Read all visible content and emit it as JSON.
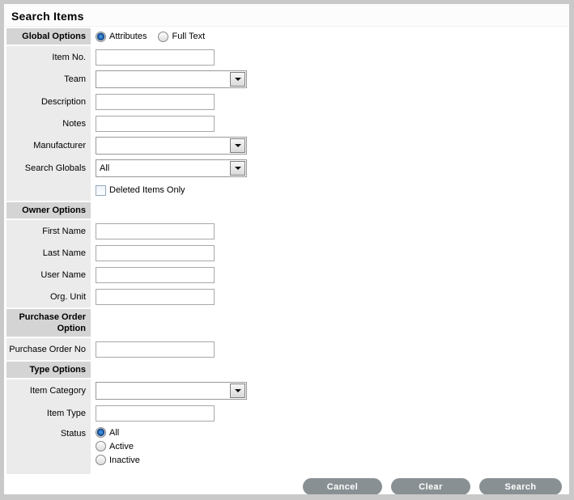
{
  "header": {
    "title": "Search Items"
  },
  "global_options": {
    "section_label": "Global Options",
    "search_mode": {
      "options": [
        {
          "label": "Attributes",
          "selected": true
        },
        {
          "label": "Full Text",
          "selected": false
        }
      ]
    },
    "fields": {
      "item_no": {
        "label": "Item No.",
        "value": ""
      },
      "team": {
        "label": "Team",
        "value": ""
      },
      "description": {
        "label": "Description",
        "value": ""
      },
      "notes": {
        "label": "Notes",
        "value": ""
      },
      "manufacturer": {
        "label": "Manufacturer",
        "value": ""
      },
      "search_globals": {
        "label": "Search Globals",
        "value": "All"
      }
    },
    "deleted_items_only": {
      "label": "Deleted Items Only",
      "checked": false
    }
  },
  "owner_options": {
    "section_label": "Owner Options",
    "fields": {
      "first_name": {
        "label": "First Name",
        "value": ""
      },
      "last_name": {
        "label": "Last Name",
        "value": ""
      },
      "user_name": {
        "label": "User Name",
        "value": ""
      },
      "org_unit": {
        "label": "Org. Unit",
        "value": ""
      }
    }
  },
  "purchase_order_option": {
    "section_label": "Purchase Order Option",
    "fields": {
      "purchase_order_no": {
        "label": "Purchase Order No",
        "value": ""
      }
    }
  },
  "type_options": {
    "section_label": "Type Options",
    "fields": {
      "item_category": {
        "label": "Item Category",
        "value": ""
      },
      "item_type": {
        "label": "Item Type",
        "value": ""
      }
    },
    "status": {
      "label": "Status",
      "options": [
        {
          "label": "All",
          "selected": true
        },
        {
          "label": "Active",
          "selected": false
        },
        {
          "label": "Inactive",
          "selected": false
        }
      ]
    }
  },
  "footer": {
    "buttons": [
      {
        "label": "Cancel"
      },
      {
        "label": "Clear"
      },
      {
        "label": "Search"
      }
    ]
  },
  "colors": {
    "frame_border": "#c9c9c9",
    "section_header_bg": "#d4d4d4",
    "label_rail_bg": "#ebebeb",
    "button_bg": "#899094",
    "button_text": "#ffffff",
    "radio_selected": "#1f64b2"
  }
}
